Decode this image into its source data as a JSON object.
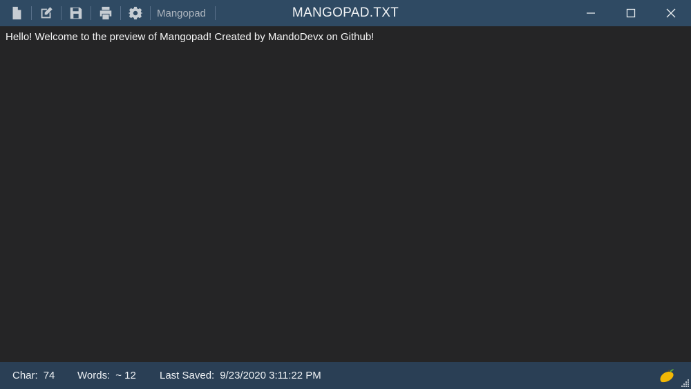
{
  "toolbar": {
    "tools": [
      {
        "name": "new-file-icon"
      },
      {
        "name": "edit-icon"
      },
      {
        "name": "save-icon"
      },
      {
        "name": "print-icon"
      },
      {
        "name": "settings-gear-icon"
      }
    ],
    "app_name": "Mangopad"
  },
  "window": {
    "title": "MANGOPAD.TXT"
  },
  "editor": {
    "content": "Hello! Welcome to the preview of Mangopad! Created by MandoDevx on Github!"
  },
  "status": {
    "char_label": "Char:",
    "char_value": "74",
    "words_label": "Words:",
    "words_value": "~ 12",
    "saved_label": "Last Saved:",
    "saved_value": "9/23/2020 3:11:22 PM"
  },
  "colors": {
    "titlebar": "#2f4a63",
    "statusbar": "#2a3f55",
    "editor_bg": "#252526",
    "text": "#f5f5f5",
    "mango": "#f2b705"
  }
}
